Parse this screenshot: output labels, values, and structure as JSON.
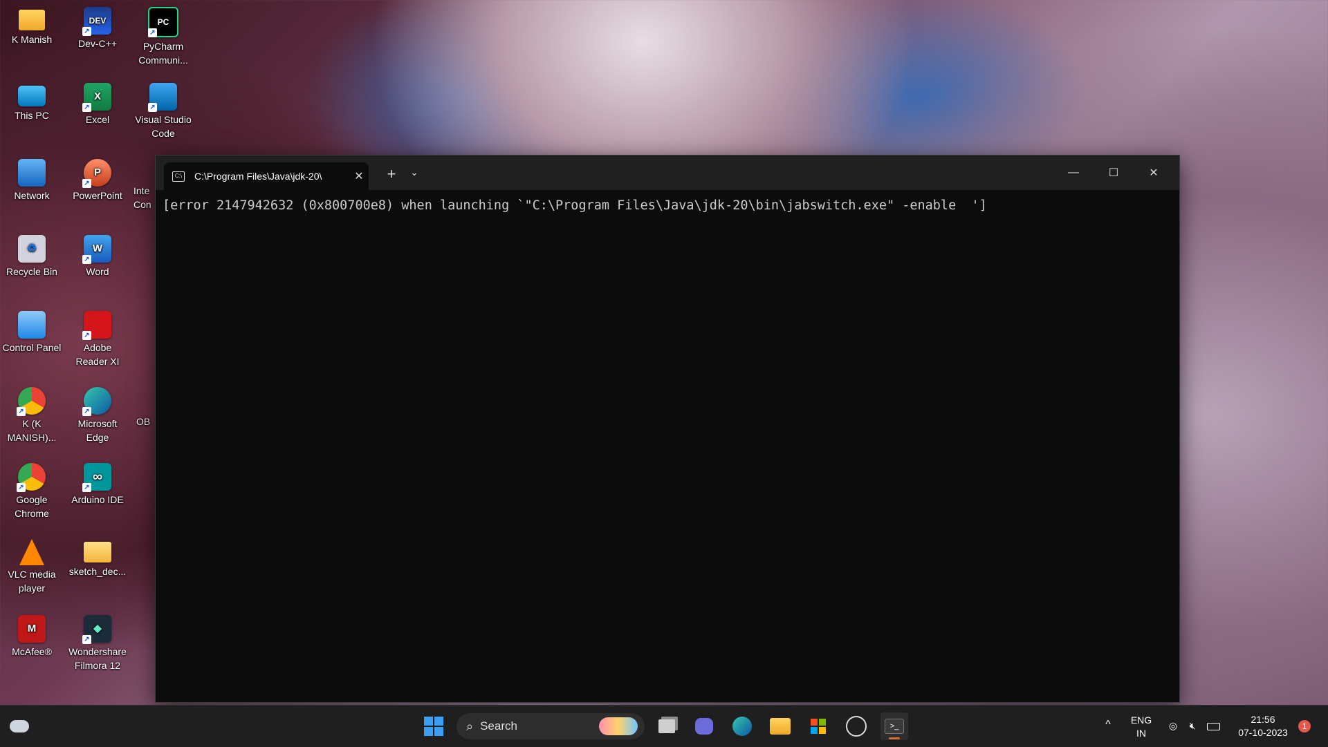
{
  "desktop": {
    "icons": [
      {
        "label": "K Manish"
      },
      {
        "label": "Dev-C++",
        "glyph": "DEV"
      },
      {
        "label": "PyCharm Communi...",
        "glyph": "PC"
      },
      {
        "label": "This PC"
      },
      {
        "label": "Excel",
        "glyph": "X"
      },
      {
        "label": "Visual Studio Code"
      },
      {
        "label": "Network"
      },
      {
        "label": "PowerPoint",
        "glyph": "P"
      },
      {
        "label": "Inte Con"
      },
      {
        "label": "Recycle Bin",
        "glyph": "♻"
      },
      {
        "label": "Word",
        "glyph": "W"
      },
      {
        "label": "Control Panel"
      },
      {
        "label": "Adobe Reader XI"
      },
      {
        "label": "K (K MANISH)..."
      },
      {
        "label": "Microsoft Edge"
      },
      {
        "label": "OB"
      },
      {
        "label": "Google Chrome"
      },
      {
        "label": "Arduino IDE",
        "glyph": "∞"
      },
      {
        "label": "VLC media player"
      },
      {
        "label": "sketch_dec..."
      },
      {
        "label": "McAfee®",
        "glyph": "M"
      },
      {
        "label": "Wondershare Filmora 12"
      }
    ]
  },
  "terminal": {
    "tab_title": "C:\\Program Files\\Java\\jdk-20\\",
    "tab_icon_glyph": "C:\\",
    "close_tab": "✕",
    "new_tab": "+",
    "dropdown": "⌄",
    "minimize": "—",
    "maximize": "☐",
    "close": "✕",
    "output": "[error 2147942632 (0x800700e8) when launching `\"C:\\Program Files\\Java\\jdk-20\\bin\\jabswitch.exe\" -enable  ']"
  },
  "taskbar": {
    "search_placeholder": "Search",
    "language_top": "ENG",
    "language_bottom": "IN",
    "time": "21:56",
    "date": "07-10-2023",
    "notification_count": "1",
    "tray_overflow": "^"
  },
  "colors": {
    "terminal_bg": "#0c0c0c",
    "titlebar_bg": "#202020",
    "taskbar_bg": "#1f1f1f",
    "accent": "#0078d4"
  }
}
